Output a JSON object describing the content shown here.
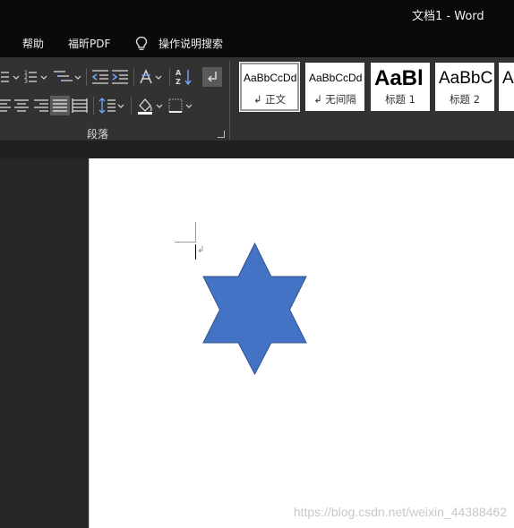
{
  "window": {
    "title": "文档1  -  Word"
  },
  "menu": {
    "help": "帮助",
    "foxit_pdf": "福昕PDF",
    "tell_me": "操作说明搜索"
  },
  "ribbon": {
    "paragraph_group_label": "段落",
    "paragraph_icons": [
      "bullets-icon",
      "numbering-icon",
      "multilevel-list-icon",
      "decrease-indent-icon",
      "increase-indent-icon",
      "chinese-layout-icon",
      "sort-icon",
      "show-marks-icon",
      "align-left-icon",
      "align-center-icon",
      "align-right-icon",
      "justify-icon",
      "distributed-icon",
      "line-spacing-icon",
      "shading-icon",
      "borders-icon"
    ],
    "styles": [
      {
        "sample": "AaBbCcDd",
        "name": "↲ 正文",
        "selected": true
      },
      {
        "sample": "AaBbCcDd",
        "name": "↲ 无间隔",
        "selected": false
      },
      {
        "sample": "AaBl",
        "name": "标题 1",
        "selected": false
      },
      {
        "sample": "AaBbC",
        "name": "标题 2",
        "selected": false
      },
      {
        "sample": "A",
        "name": "",
        "selected": false
      }
    ]
  },
  "document": {
    "paragraph_mark": "↲",
    "shape": {
      "type": "six-point-star",
      "fill": "#4472C4",
      "stroke": "#2F528F"
    }
  },
  "watermark": "https://blog.csdn.net/weixin_44388462",
  "colors": {
    "background": "#262626",
    "ribbon": "#323232",
    "titlebar": "#0a0a0a",
    "page": "#ffffff"
  }
}
